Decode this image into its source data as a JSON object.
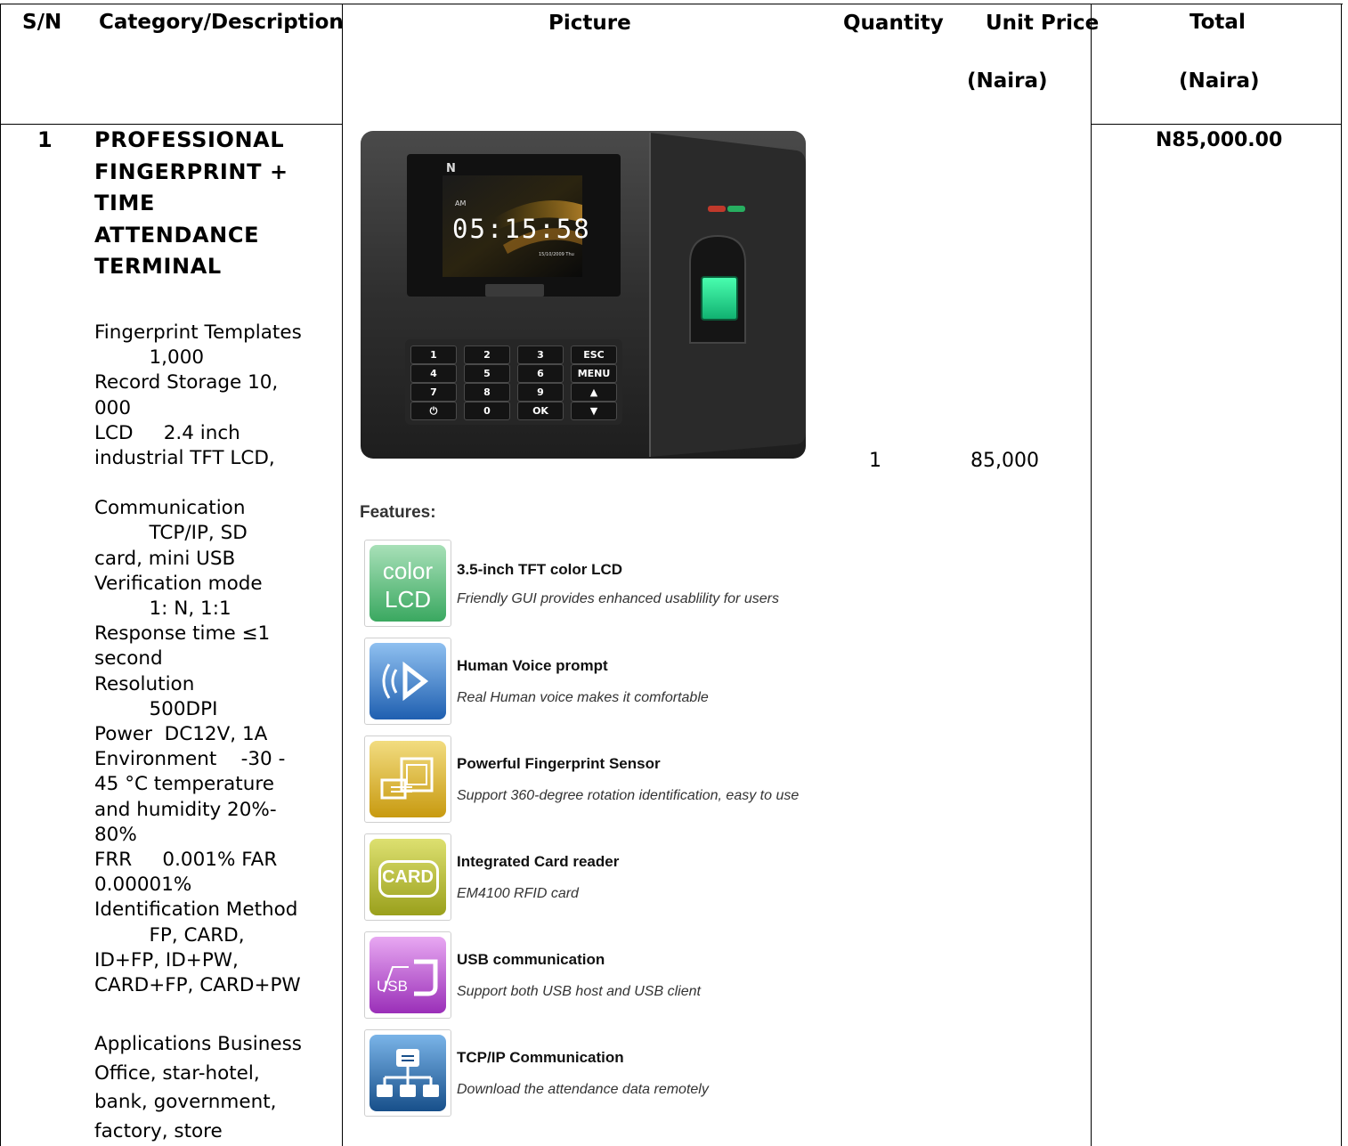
{
  "header": {
    "sn": "S/N",
    "category": "Category/Description",
    "picture": "Picture",
    "quantity": "Quantity",
    "unit_price": "Unit Price",
    "unit_price_currency": "(Naira)",
    "total": "Total",
    "total_currency": "(Naira)"
  },
  "item": {
    "sn": "1",
    "title_lines": [
      "PROFESSIONAL",
      "FINGERPRINT +",
      "TIME",
      "ATTENDANCE",
      "TERMINAL"
    ],
    "spec_lines": [
      "Fingerprint Templates",
      "         1,000",
      "Record Storage 10,",
      "000",
      "LCD     2.4 inch",
      "industrial TFT LCD,",
      "",
      "Communication",
      "         TCP/IP, SD",
      "card, mini USB",
      "Verification mode",
      "         1: N, 1:1",
      "Response time ≤1",
      "second",
      "Resolution",
      "         500DPI",
      "Power  DC12V, 1A",
      "Environment    -30 -",
      "45 °C temperature",
      "and humidity 20%-",
      "80%",
      "FRR     0.001% FAR",
      "0.00001%",
      "Identification Method",
      "         FP, CARD,",
      "ID+FP, ID+PW,",
      "CARD+FP, CARD+PW"
    ],
    "applications_lines": [
      "Applications Business",
      "Office, star-hotel,",
      "bank, government,",
      "factory, store"
    ],
    "quantity": "1",
    "unit_price": "85,000",
    "total": "N85,000.00"
  },
  "device": {
    "screen_am": "AM",
    "screen_time": "05:15:58",
    "screen_date": "15/10/2009 Thu",
    "screen_logo": "N",
    "keys": [
      [
        "1",
        "2",
        "3",
        "ESC"
      ],
      [
        "4",
        "5",
        "6",
        "MENU"
      ],
      [
        "7",
        "8",
        "9",
        "▲"
      ],
      [
        "⏻",
        "0",
        "OK",
        "▼"
      ]
    ]
  },
  "features": {
    "heading": "Features:",
    "items": [
      {
        "title": "3.5-inch TFT color LCD",
        "subtitle": "Friendly GUI provides enhanced usablility for users",
        "icon": "color-lcd-icon",
        "icon_text": [
          "color",
          "LCD"
        ],
        "color": "#43b06b"
      },
      {
        "title": "Human Voice prompt",
        "subtitle": "Real Human voice makes it comfortable",
        "icon": "speaker-icon",
        "color": "#2f6fc0"
      },
      {
        "title": "Powerful Fingerprint Sensor",
        "subtitle": "Support 360-degree rotation identification, easy to use",
        "icon": "fingerprint-sensor-icon",
        "color": "#c9a419"
      },
      {
        "title": "Integrated Card reader",
        "subtitle": "EM4100 RFID card",
        "icon": "card-icon",
        "icon_text": [
          "CARD"
        ],
        "color": "#aab22a"
      },
      {
        "title": "USB communication",
        "subtitle": "Support both USB host and USB client",
        "icon": "usb-icon",
        "icon_text": [
          "USB"
        ],
        "color": "#a43fbf"
      },
      {
        "title": "TCP/IP Communication",
        "subtitle": "Download the attendance data remotely",
        "icon": "network-icon",
        "color": "#1f5f9e"
      }
    ]
  }
}
